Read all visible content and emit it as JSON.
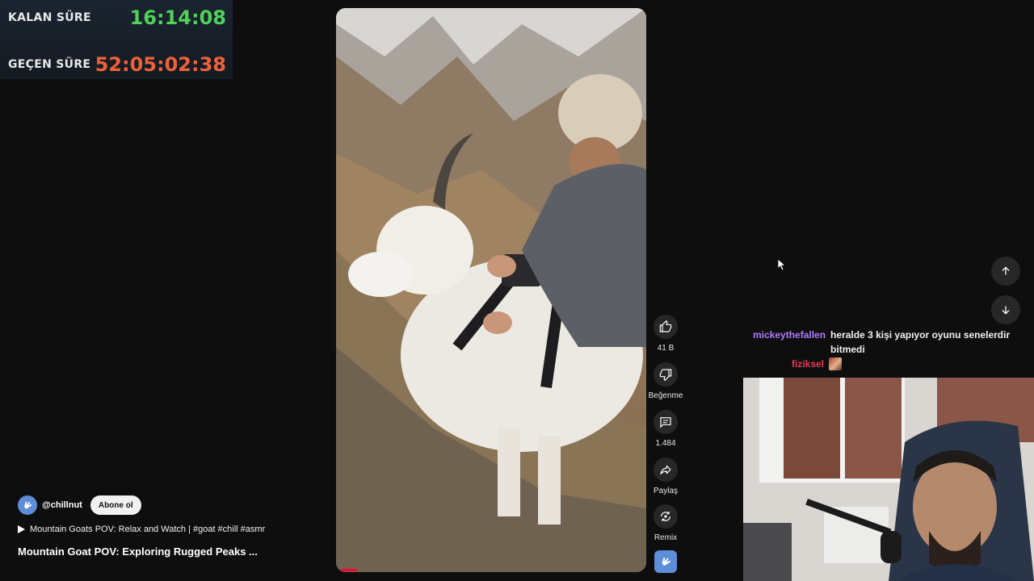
{
  "timer": {
    "remaining_label": "KALAN SÜRE",
    "remaining_value": "16:14:08",
    "elapsed_label": "GEÇEN SÜRE",
    "elapsed_value": "52:05:02:38"
  },
  "actions": {
    "like_count": "41 B",
    "dislike_label": "Beğenme",
    "comment_count": "1.484",
    "share_label": "Paylaş",
    "remix_label": "Remix"
  },
  "channel": {
    "handle": "@chillnut",
    "subscribe_label": "Abone ol"
  },
  "playlist": {
    "title": "Mountain Goats POV: Relax and Watch | #goat #chill #asmr"
  },
  "video": {
    "title": "Mountain Goat POV: Exploring Rugged Peaks ..."
  },
  "chat": [
    {
      "user": "mickeythefallen",
      "message": "heralde 3 kişi yapıyor oyunu senelerdir bitmedi"
    },
    {
      "user": "fiziksel",
      "message": ""
    }
  ],
  "colors": {
    "timer_green": "#4fd15a",
    "timer_red": "#ee6038",
    "chat_user_1": "#b07bff",
    "chat_user_2": "#e43b5a",
    "progress": "#ff0033"
  },
  "icons": [
    "thumbs-up-icon",
    "thumbs-down-icon",
    "comment-icon",
    "share-icon",
    "remix-icon",
    "arrow-up-icon",
    "arrow-down-icon",
    "play-icon"
  ]
}
